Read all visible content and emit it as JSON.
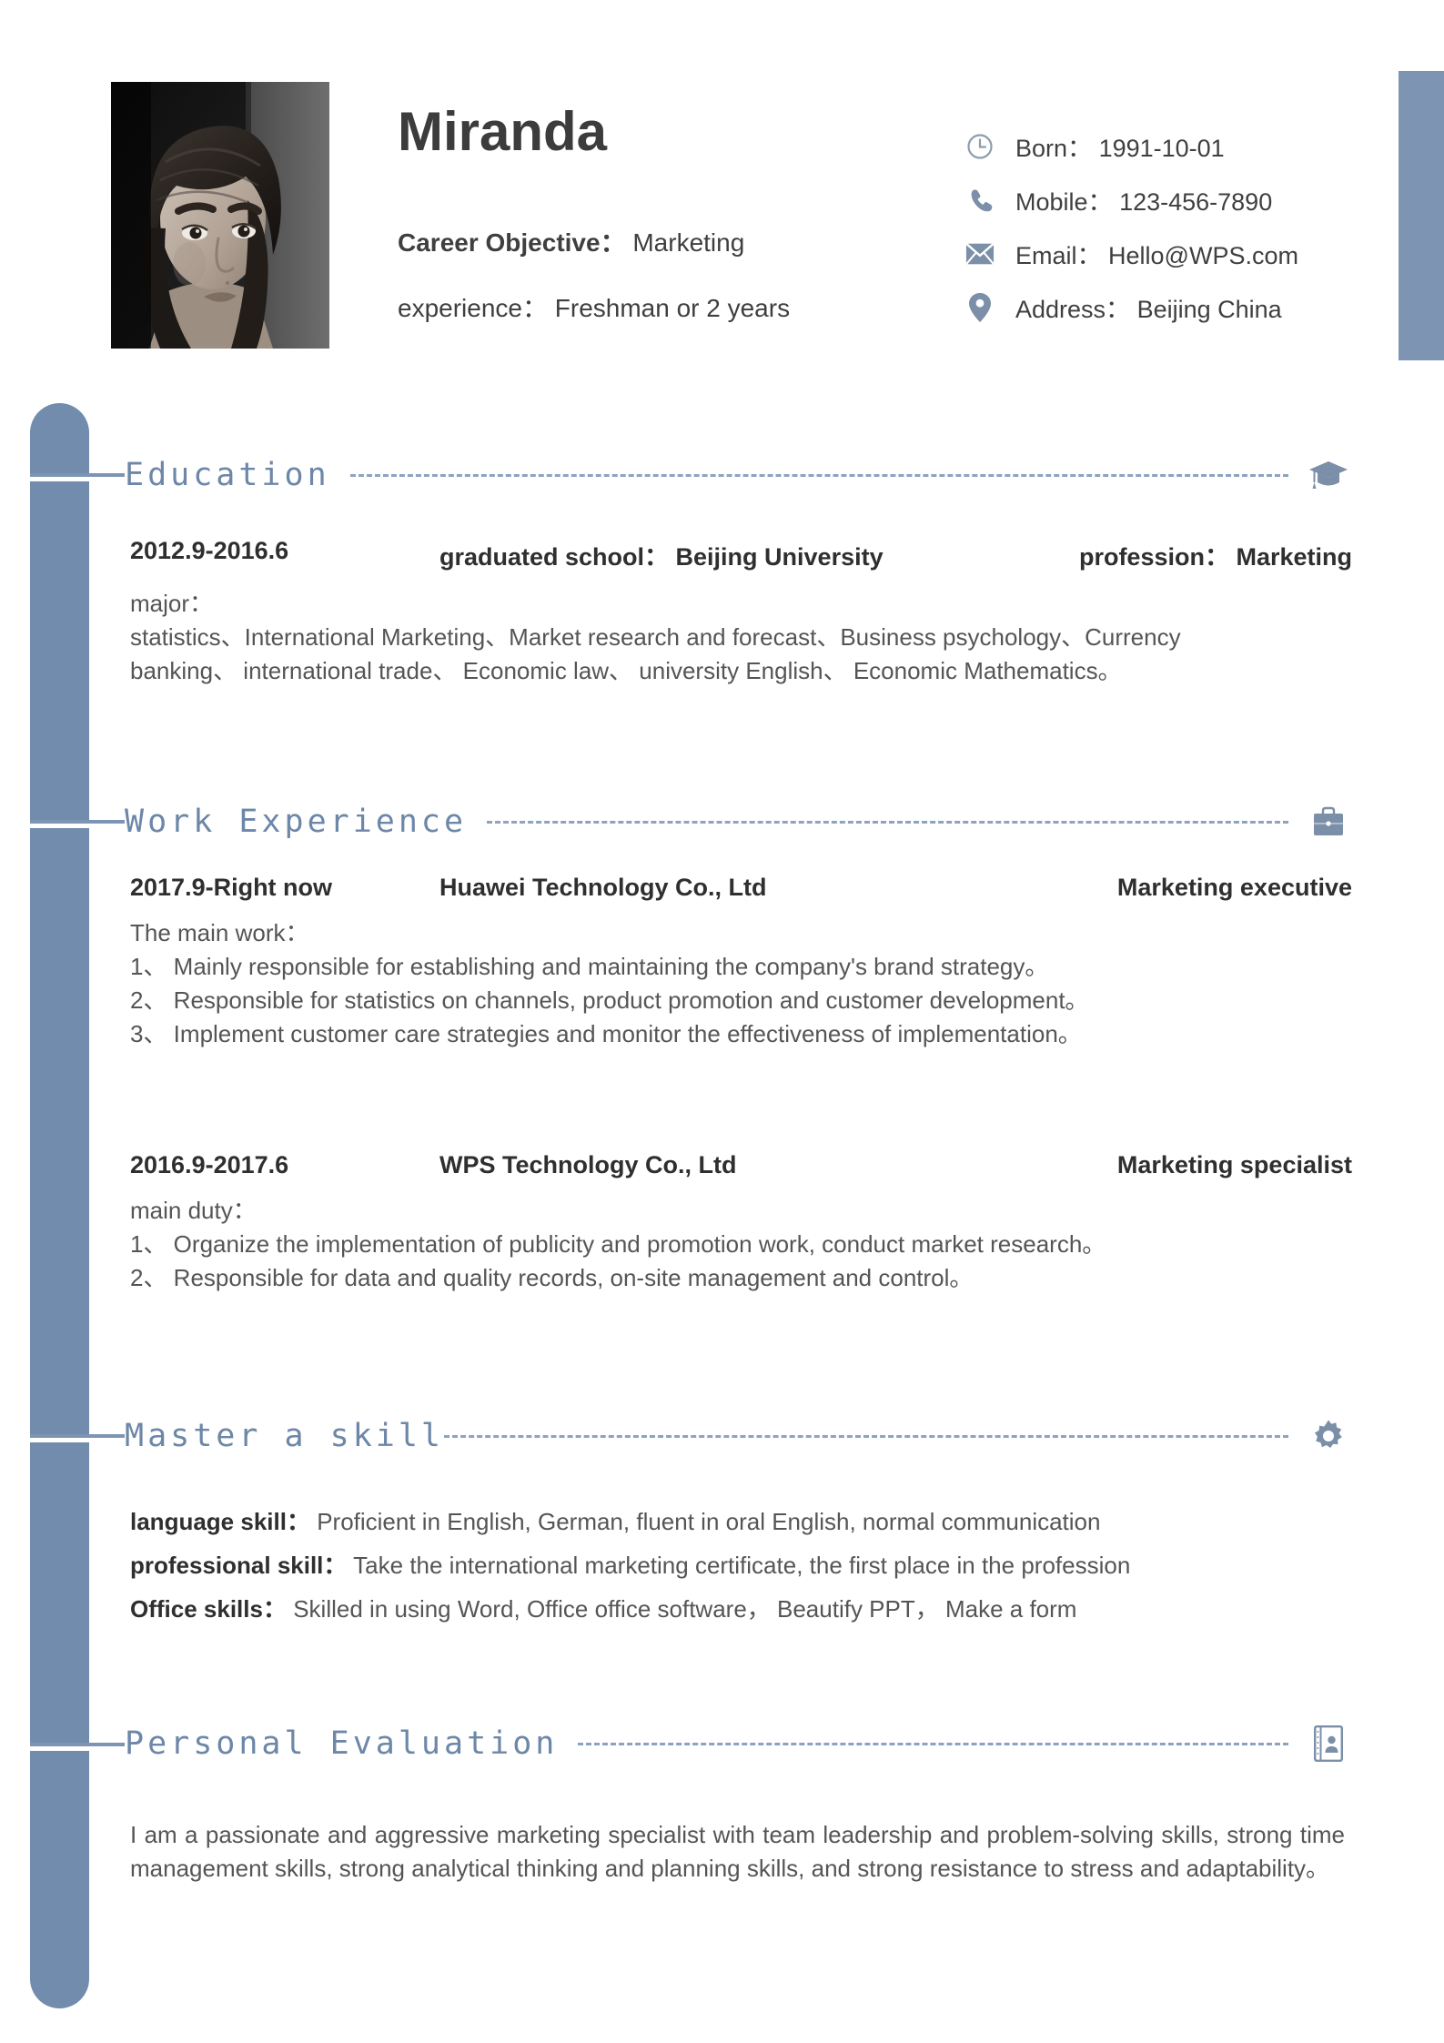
{
  "theme": {
    "accent": "#728cad",
    "accent_light": "#8ca3bf",
    "heading_color": "#6d87a8",
    "text_color": "#555555",
    "strong_color": "#2f2f2f"
  },
  "header": {
    "name": "Miranda",
    "objective_label": "Career Objective：",
    "objective_value": "Marketing",
    "experience_label": "experience：",
    "experience_value": "Freshman or 2 years",
    "photo_alt": "portrait-photo",
    "contacts": [
      {
        "icon": "clock-icon",
        "label": "Born：",
        "value": "1991-10-01"
      },
      {
        "icon": "phone-icon",
        "label": "Mobile：",
        "value": "123-456-7890"
      },
      {
        "icon": "envelope-icon",
        "label": "Email：",
        "value": "Hello@WPS.com"
      },
      {
        "icon": "location-icon",
        "label": "Address：",
        "value": "Beijing China"
      }
    ]
  },
  "sections": {
    "education": {
      "title": "Education",
      "icon": "graduation-cap-icon",
      "dates": "2012.9-2016.6",
      "school_label": "graduated school： Beijing University",
      "profession_label": "profession： Marketing",
      "major_label": "major：",
      "major_line1": "statistics、International Marketing、Market research and forecast、Business psychology、Currency",
      "major_line2": "banking、 international trade、 Economic law、 university English、 Economic Mathematics。"
    },
    "work": {
      "title": "Work Experience",
      "icon": "briefcase-icon",
      "jobs": [
        {
          "dates": "2017.9-Right now",
          "company": "Huawei Technology Co., Ltd",
          "role": "Marketing executive",
          "duty_label": "The main work：",
          "duties": [
            "1、 Mainly responsible for establishing and maintaining the company's brand strategy。",
            "2、 Responsible for statistics on channels, product promotion and customer development。",
            "3、 Implement customer care strategies and monitor the effectiveness of implementation。"
          ]
        },
        {
          "dates": "2016.9-2017.6",
          "company": "WPS Technology Co., Ltd",
          "role": "Marketing specialist",
          "duty_label": "main duty：",
          "duties": [
            "1、 Organize the implementation of publicity and promotion work, conduct market research。",
            "2、 Responsible for data and quality records, on-site management and control。"
          ]
        }
      ]
    },
    "skills": {
      "title": "Master a skill",
      "icon": "gear-icon",
      "items": [
        {
          "label": "language skill：",
          "value": "Proficient in English, German, fluent in oral English, normal communication"
        },
        {
          "label": "professional skill：",
          "value": "Take the international marketing certificate, the first place in the profession"
        },
        {
          "label": "Office skills：",
          "value": "Skilled in using Word, Office office software， Beautify PPT， Make a form"
        }
      ]
    },
    "evaluation": {
      "title": "Personal Evaluation",
      "icon": "id-card-icon",
      "text": "I am a passionate and aggressive marketing specialist with team leadership and problem-solving skills, strong time management skills, strong analytical thinking and planning skills, and strong resistance to stress and adaptability。"
    }
  }
}
